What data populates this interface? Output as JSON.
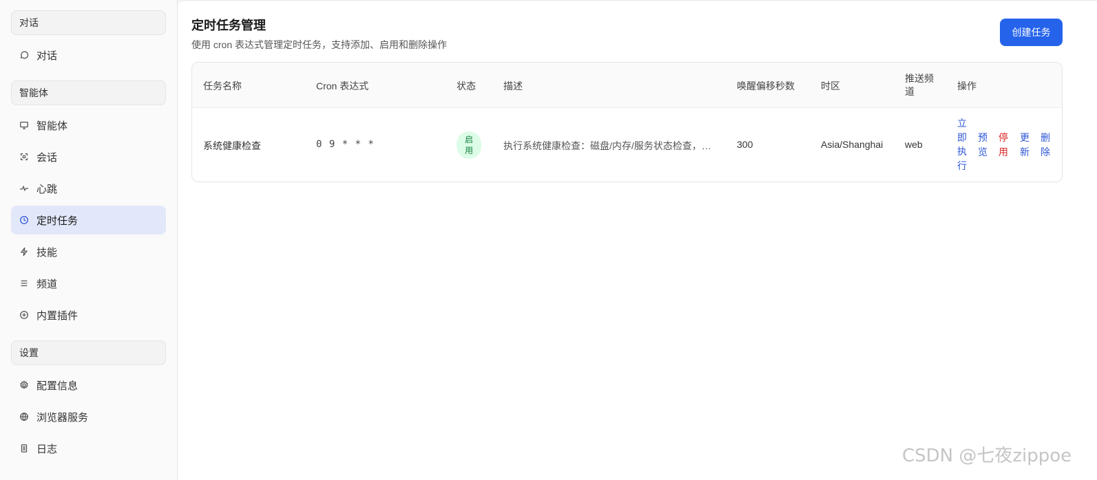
{
  "sidebar": {
    "groups": [
      {
        "header": "对话",
        "items": [
          {
            "label": "对话",
            "icon": "chat-bubble-icon"
          }
        ]
      },
      {
        "header": "智能体",
        "items": [
          {
            "label": "智能体",
            "icon": "monitor-icon"
          },
          {
            "label": "会话",
            "icon": "session-icon"
          },
          {
            "label": "心跳",
            "icon": "pulse-icon"
          },
          {
            "label": "定时任务",
            "icon": "clock-icon",
            "active": true
          },
          {
            "label": "技能",
            "icon": "lightning-icon"
          },
          {
            "label": "频道",
            "icon": "menu-lines-icon"
          },
          {
            "label": "内置插件",
            "icon": "plus-circle-icon"
          }
        ]
      },
      {
        "header": "设置",
        "items": [
          {
            "label": "配置信息",
            "icon": "gear-icon"
          },
          {
            "label": "浏览器服务",
            "icon": "globe-icon"
          },
          {
            "label": "日志",
            "icon": "document-icon"
          }
        ]
      }
    ]
  },
  "page": {
    "title": "定时任务管理",
    "subtitle": "使用 cron 表达式管理定时任务，支持添加、启用和删除操作",
    "create_button": "创建任务"
  },
  "table": {
    "columns": [
      "任务名称",
      "Cron 表达式",
      "状态",
      "描述",
      "唤醒偏移秒数",
      "时区",
      "推送频道",
      "操作"
    ],
    "rows": [
      {
        "name": "系统健康检查",
        "cron": "0 9 * * *",
        "status": "启用",
        "description": "执行系统健康检查：磁盘/内存/服务状态检查，…",
        "wake_offset": "300",
        "timezone": "Asia/Shanghai",
        "channel": "web",
        "actions": [
          "立即执行",
          "预览",
          "停用",
          "更新",
          "删除"
        ]
      }
    ]
  },
  "watermark": "CSDN @七夜zippoe",
  "colors": {
    "accent": "#2563eb",
    "active_bg": "#e2e8fa",
    "status_bg": "#dcfce7",
    "status_text": "#15803d",
    "danger": "#dc2626"
  }
}
